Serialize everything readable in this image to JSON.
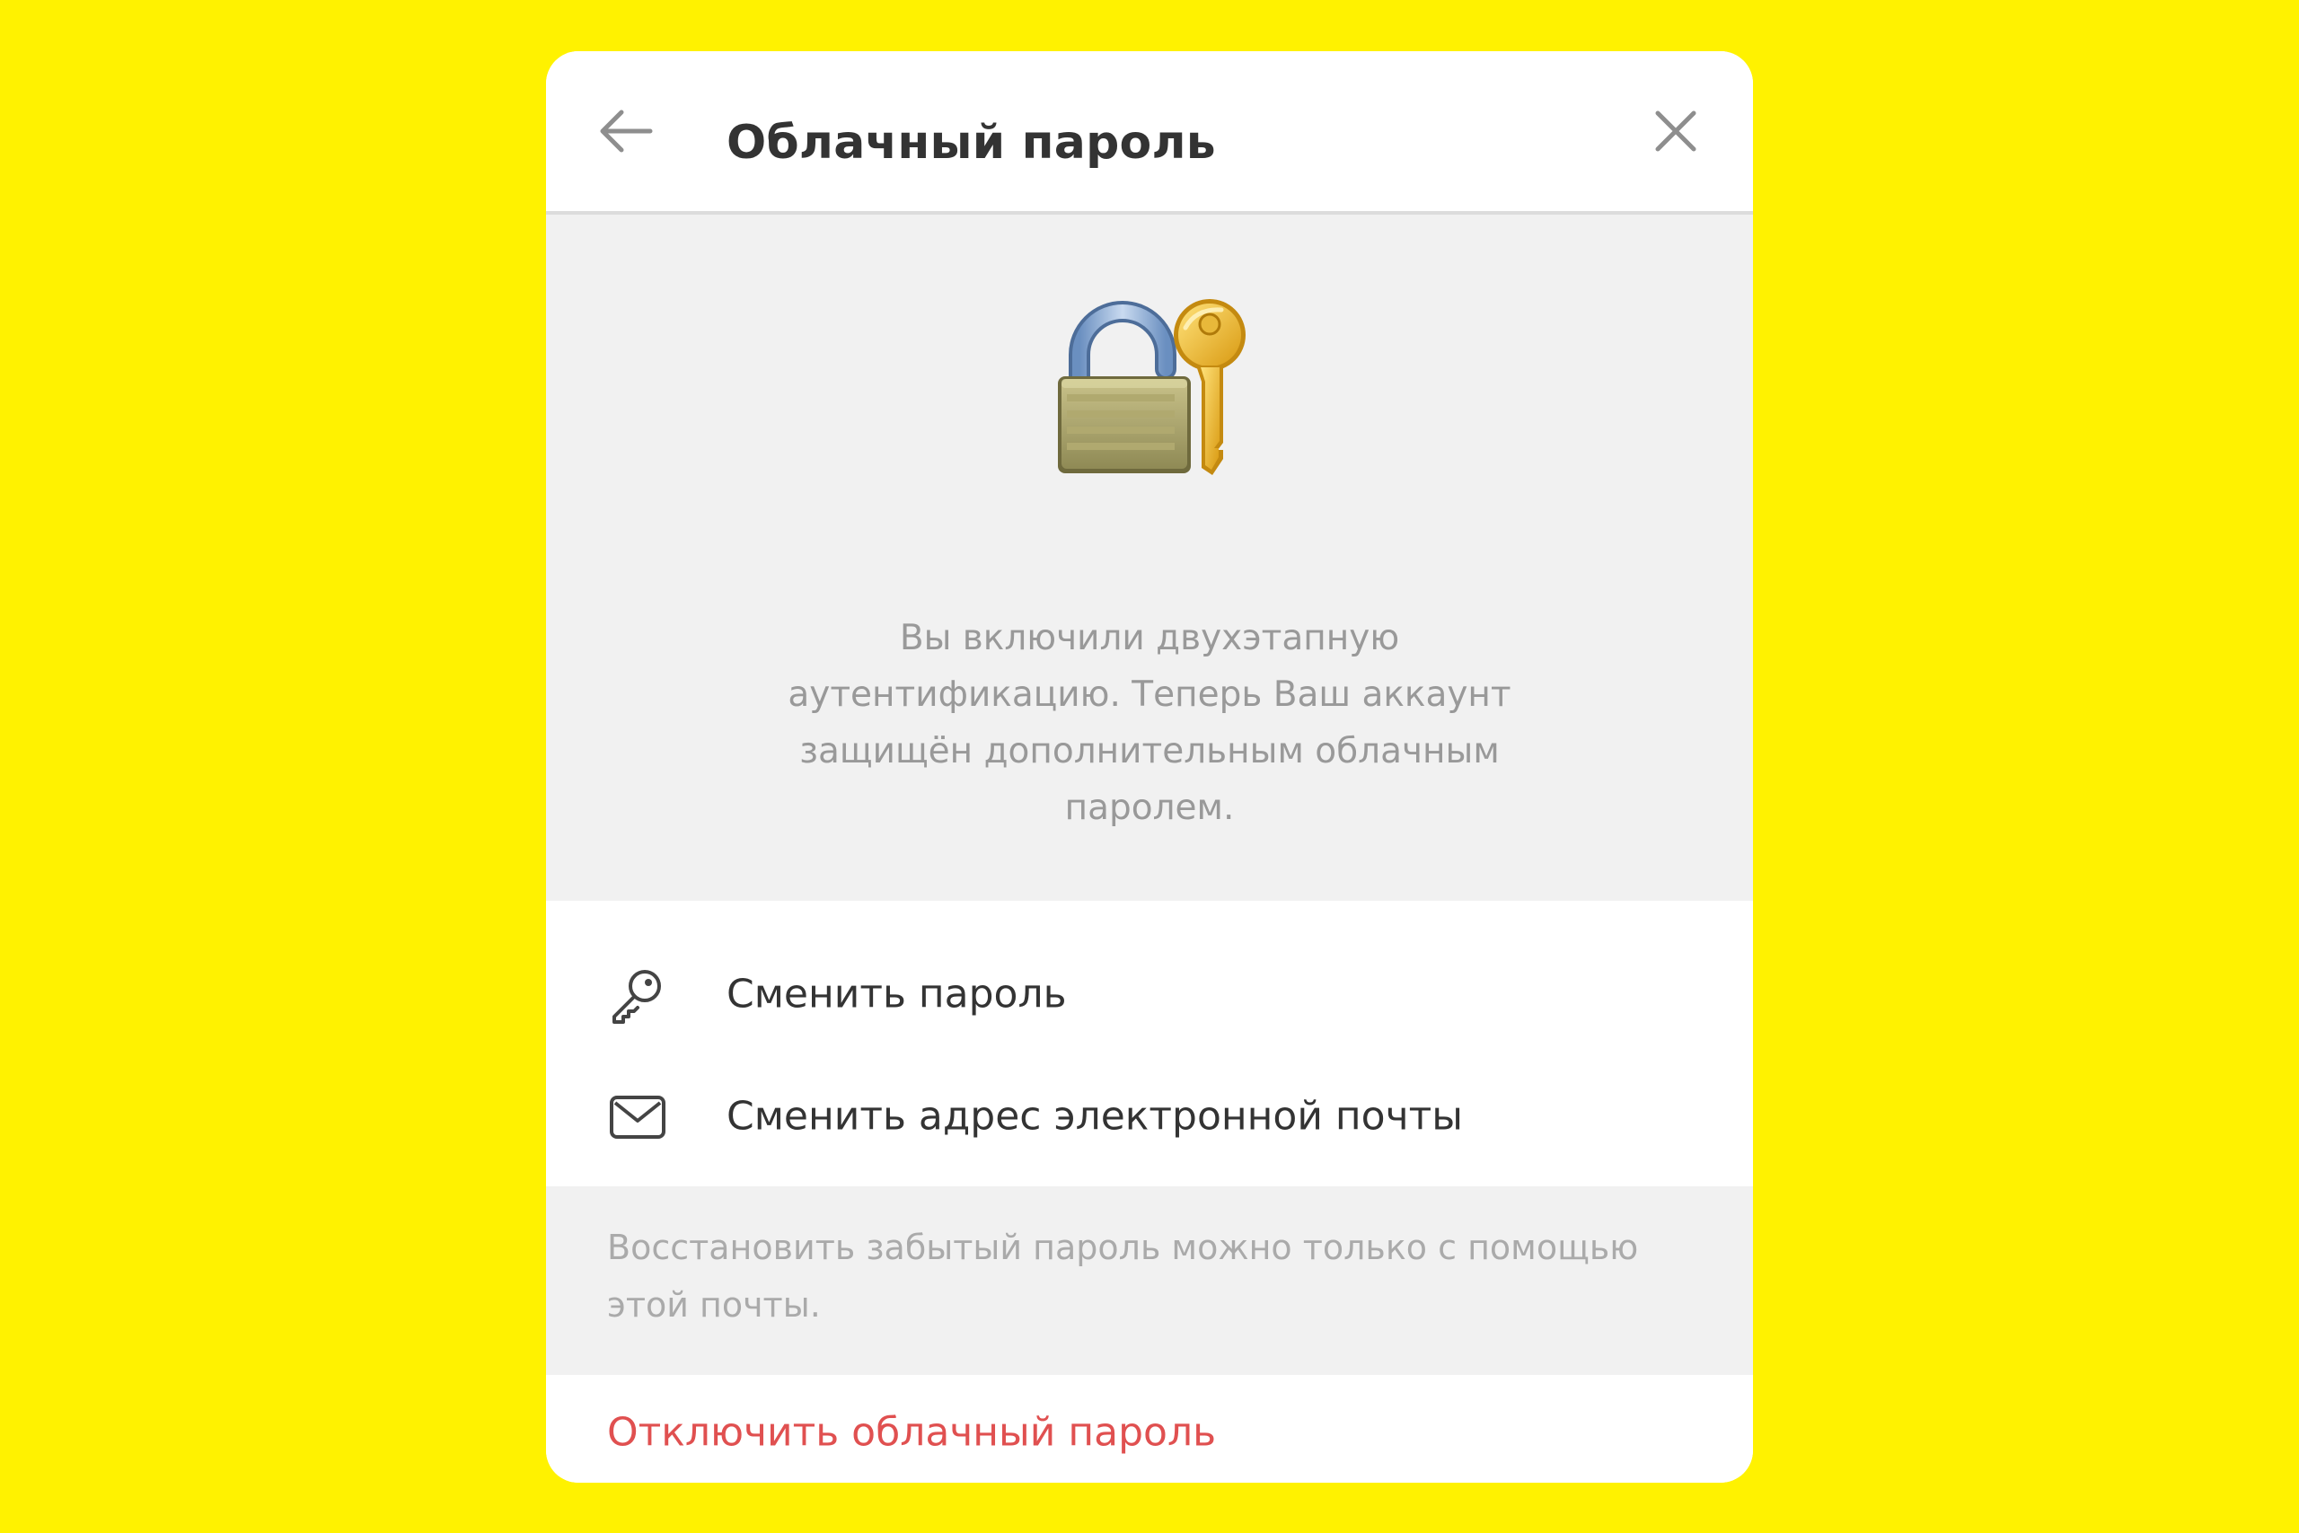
{
  "colors": {
    "background": "#FFF200",
    "dialog": "#FFFFFF",
    "panel_gray": "#F1F1F1",
    "title_text": "#333333",
    "muted_text": "#999999",
    "danger": "#E05050"
  },
  "header": {
    "title": "Облачный пароль",
    "back_icon": "arrow-left-icon",
    "close_icon": "close-icon"
  },
  "hero": {
    "illustration": "lock-with-key-icon",
    "description": "Вы включили двухэтапную\nаутентификацию. Теперь Ваш аккаунт\nзащищён дополнительным облачным\nпаролем."
  },
  "actions": [
    {
      "icon": "key-icon",
      "label": "Сменить пароль"
    },
    {
      "icon": "mail-icon",
      "label": "Сменить адрес электронной почты"
    }
  ],
  "note": {
    "text": "Восстановить забытый пароль можно только с помощью этой почты."
  },
  "danger": {
    "label": "Отключить облачный пароль"
  }
}
